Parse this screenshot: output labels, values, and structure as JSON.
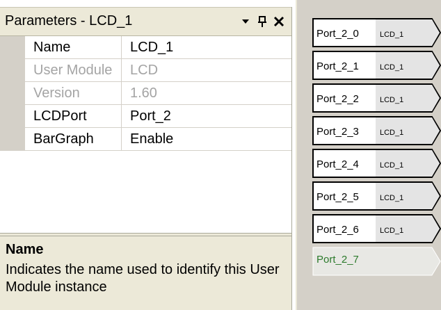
{
  "panel": {
    "title": "Parameters - LCD_1",
    "buttons": {
      "dropdown_icon": "dropdown-arrow-icon",
      "pin_icon": "pin-icon",
      "close_icon": "close-icon"
    },
    "properties": [
      {
        "name": "Name",
        "value": "LCD_1",
        "enabled": true
      },
      {
        "name": "User Module",
        "value": "LCD",
        "enabled": false
      },
      {
        "name": "Version",
        "value": "1.60",
        "enabled": false
      },
      {
        "name": "LCDPort",
        "value": "Port_2",
        "enabled": true
      },
      {
        "name": "BarGraph",
        "value": "Enable",
        "enabled": true
      }
    ],
    "description": {
      "title": "Name",
      "text": "Indicates the name used to identify this User Module instance"
    }
  },
  "pins": [
    {
      "port": "Port_2_0",
      "module": "LCD_1",
      "assigned": true
    },
    {
      "port": "Port_2_1",
      "module": "LCD_1",
      "assigned": true
    },
    {
      "port": "Port_2_2",
      "module": "LCD_1",
      "assigned": true
    },
    {
      "port": "Port_2_3",
      "module": "LCD_1",
      "assigned": true
    },
    {
      "port": "Port_2_4",
      "module": "LCD_1",
      "assigned": true
    },
    {
      "port": "Port_2_5",
      "module": "LCD_1",
      "assigned": true
    },
    {
      "port": "Port_2_6",
      "module": "LCD_1",
      "assigned": true
    },
    {
      "port": "Port_2_7",
      "module": "",
      "assigned": false
    }
  ],
  "colors": {
    "panel_bg": "#ece9d8",
    "pins_bg": "#d4d0c8",
    "unassigned_pin_text": "#2c7a2c",
    "disabled_text": "#a4a4a4"
  }
}
